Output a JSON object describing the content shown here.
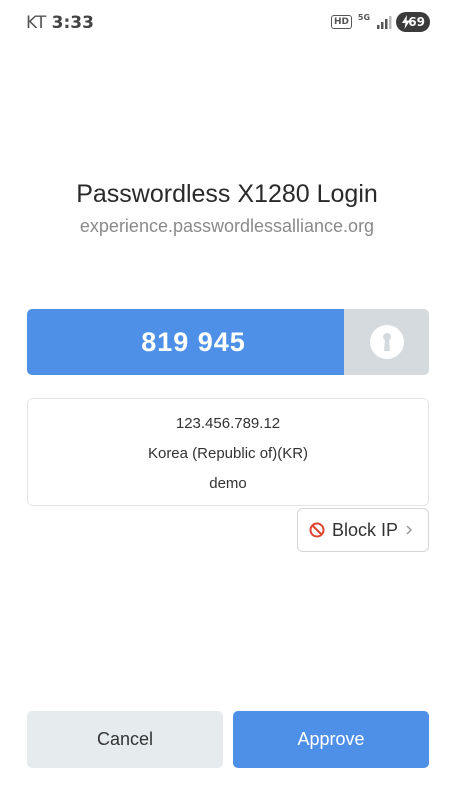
{
  "status_bar": {
    "carrier": "KT",
    "time": "3:33",
    "hd_label": "HD",
    "network_label": "5G",
    "battery_level": "69"
  },
  "header": {
    "title": "Passwordless X1280 Login",
    "subtitle": "experience.passwordlessalliance.org"
  },
  "code": {
    "value": "819 945",
    "icon": "keyhole-icon"
  },
  "info": {
    "ip": "123.456.789.12",
    "country": "Korea (Republic of)(KR)",
    "user": "demo"
  },
  "block_ip": {
    "label": "Block IP",
    "icon": "ban-icon"
  },
  "actions": {
    "cancel_label": "Cancel",
    "approve_label": "Approve"
  },
  "colors": {
    "accent": "#4e90e8",
    "key_bg": "#d5dade",
    "cancel_bg": "#e6ebee",
    "block_icon": "#e0442f"
  }
}
